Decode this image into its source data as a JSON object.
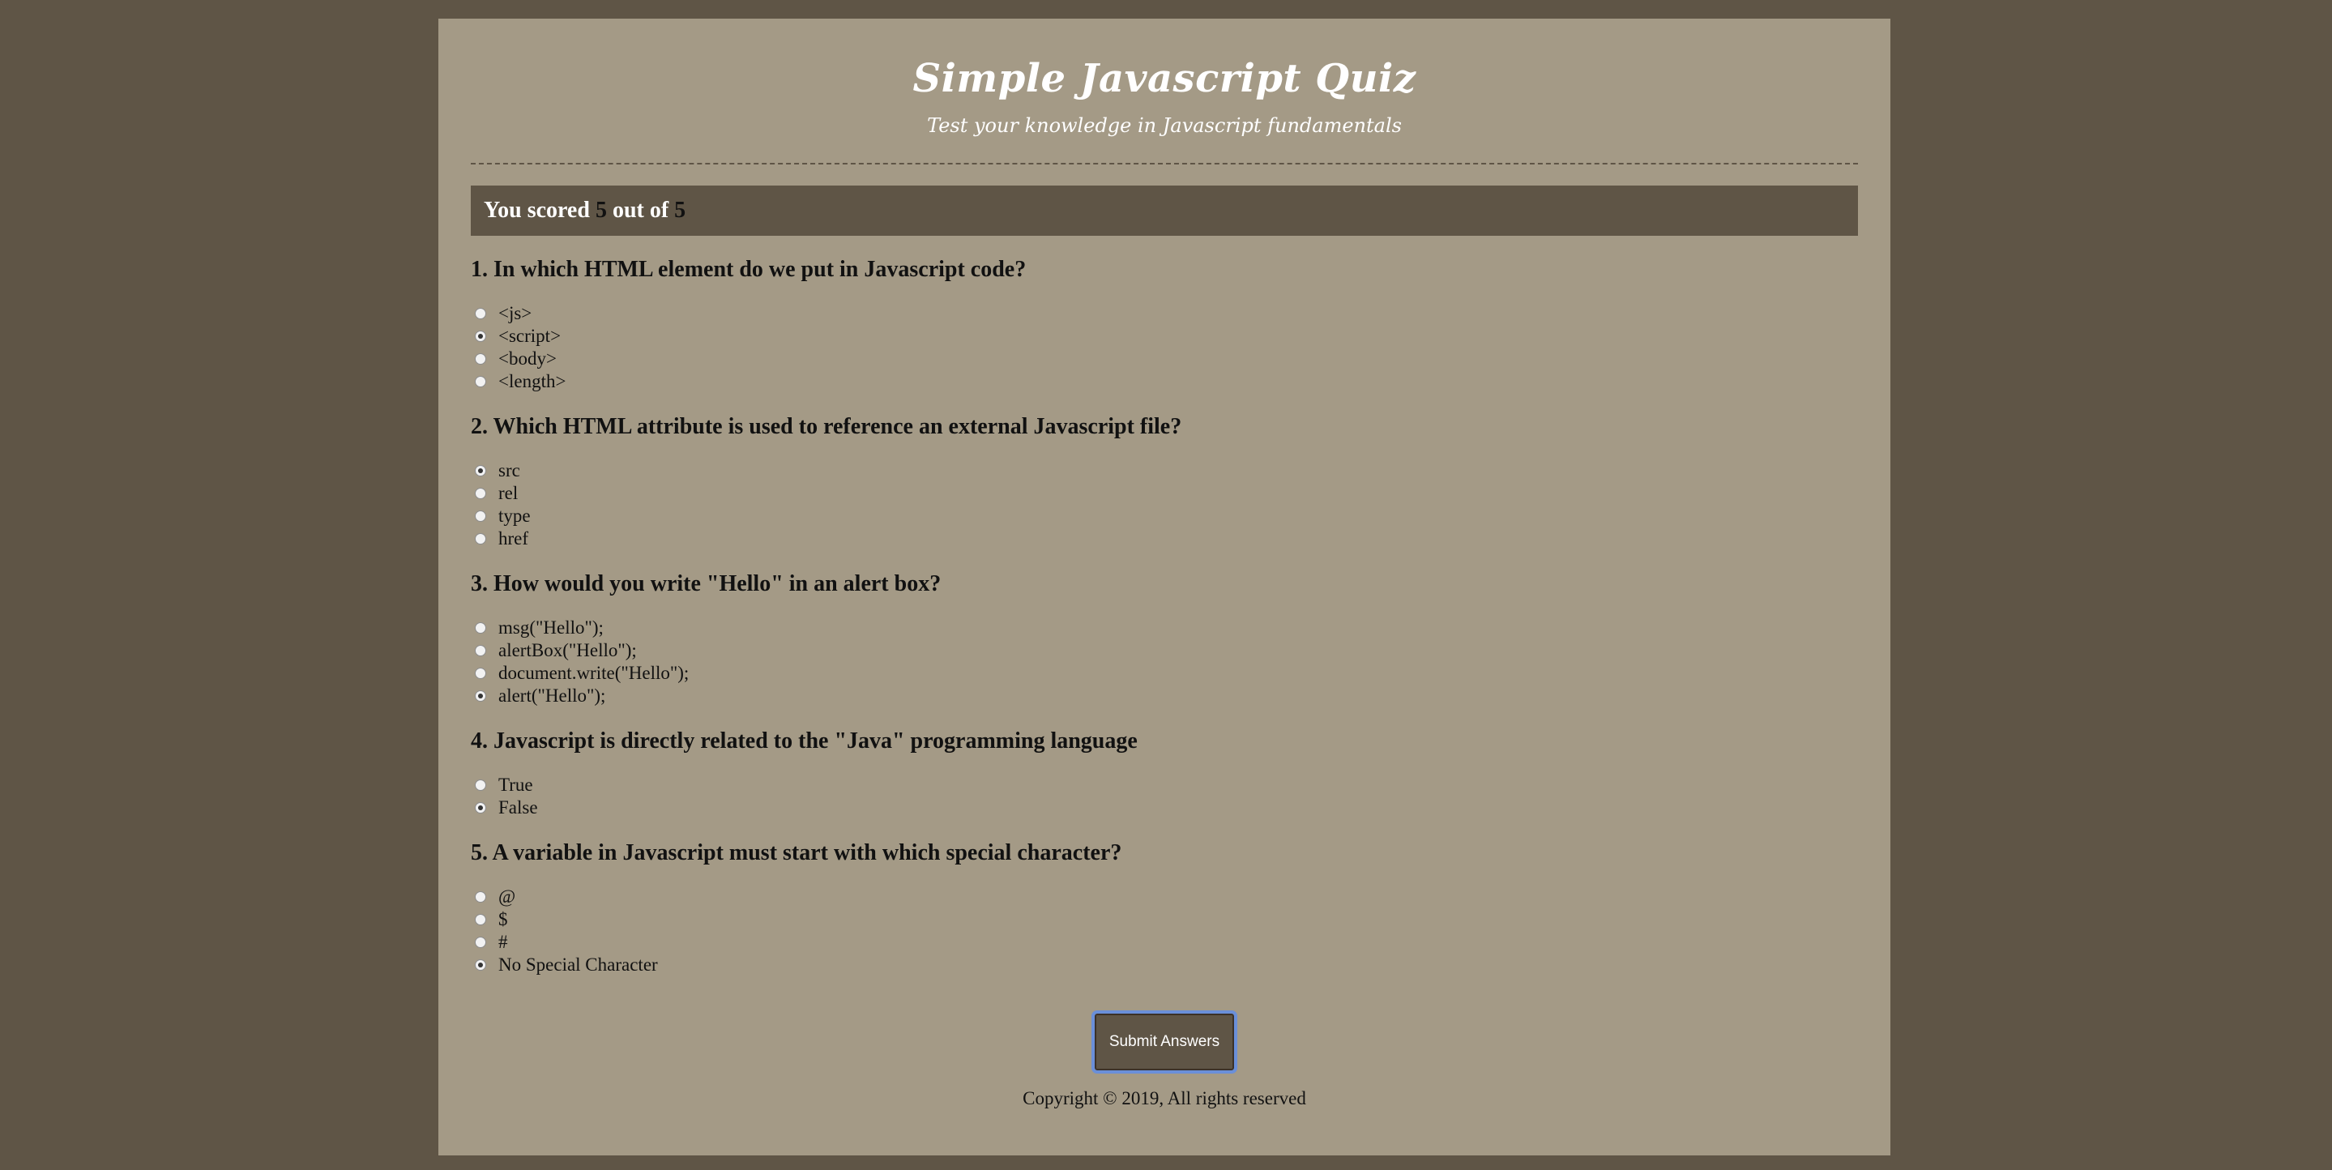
{
  "header": {
    "title": "Simple Javascript Quiz",
    "subtitle": "Test your knowledge in Javascript fundamentals"
  },
  "results": {
    "prefix": "You scored",
    "score": "5",
    "middle": "out of",
    "total": "5"
  },
  "questions": [
    {
      "text": "1. In which HTML element do we put in Javascript code?",
      "answers": [
        "<js>",
        "<script>",
        "<body>",
        "<length>"
      ],
      "selected_index": 1
    },
    {
      "text": "2. Which HTML attribute is used to reference an external Javascript file?",
      "answers": [
        "src",
        "rel",
        "type",
        "href"
      ],
      "selected_index": 0
    },
    {
      "text": "3. How would you write \"Hello\" in an alert box?",
      "answers": [
        "msg(\"Hello\");",
        "alertBox(\"Hello\");",
        "document.write(\"Hello\");",
        "alert(\"Hello\");"
      ],
      "selected_index": 3
    },
    {
      "text": "4. Javascript is directly related to the \"Java\" programming language",
      "answers": [
        "True",
        "False"
      ],
      "selected_index": 1
    },
    {
      "text": "5. A variable in Javascript must start with which special character?",
      "answers": [
        "@",
        "$",
        "#",
        "No Special Character"
      ],
      "selected_index": 3
    }
  ],
  "submit": {
    "label": "Submit Answers"
  },
  "footer": {
    "copyright": "Copyright © 2019, All rights reserved"
  }
}
